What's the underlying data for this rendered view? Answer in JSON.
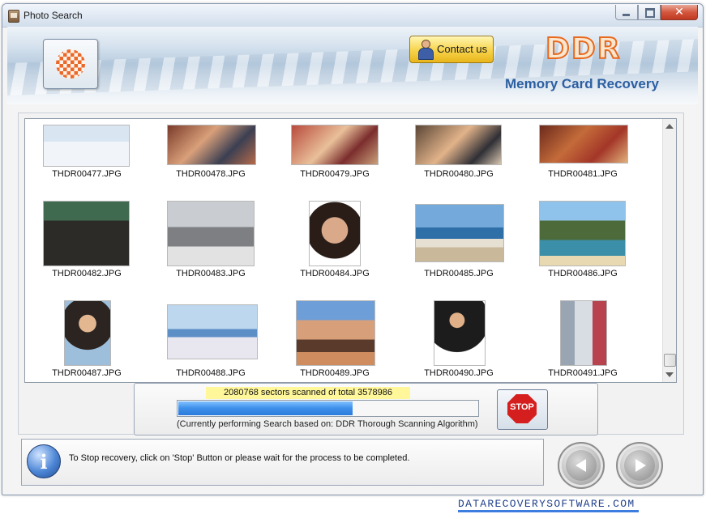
{
  "window": {
    "title": "Photo Search",
    "close_glyph": "✕",
    "icon": "photo-app-icon"
  },
  "header": {
    "contact_label": "Contact us",
    "brand": "DDR",
    "tagline": "Memory Card Recovery",
    "logo_icon": "checker-logo-icon"
  },
  "gallery": {
    "items": [
      {
        "name": "THDR00477.JPG",
        "photo": "skiers-on-snow"
      },
      {
        "name": "THDR00478.JPG",
        "photo": "group-at-table"
      },
      {
        "name": "THDR00479.JPG",
        "photo": "people-gathering"
      },
      {
        "name": "THDR00480.JPG",
        "photo": "man-at-event"
      },
      {
        "name": "THDR00481.JPG",
        "photo": "crowd-dancing"
      },
      {
        "name": "THDR00482.JPG",
        "photo": "two-men-standing"
      },
      {
        "name": "THDR00483.JPG",
        "photo": "office-desk"
      },
      {
        "name": "THDR00484.JPG",
        "photo": "woman-portrait"
      },
      {
        "name": "THDR00485.JPG",
        "photo": "beach-shore"
      },
      {
        "name": "THDR00486.JPG",
        "photo": "rocky-island-boats"
      },
      {
        "name": "THDR00487.JPG",
        "photo": "woman-posing"
      },
      {
        "name": "THDR00488.JPG",
        "photo": "beach-umbrella"
      },
      {
        "name": "THDR00489.JPG",
        "photo": "group-of-friends"
      },
      {
        "name": "THDR00490.JPG",
        "photo": "businesswoman-seated"
      },
      {
        "name": "THDR00491.JPG",
        "photo": "woman-standing"
      }
    ]
  },
  "progress": {
    "sectors_text": "2080768 sectors scanned of total 3578986",
    "scanned": 2080768,
    "total": 3578986,
    "algorithm_text": "(Currently performing Search based on:  DDR Thorough Scanning Algorithm)",
    "stop_label": "STOP"
  },
  "status": {
    "info_glyph": "i",
    "text": "To Stop recovery, click on 'Stop' Button or please wait for the process to be completed."
  },
  "footer": {
    "link": "DATARECOVERYSOFTWARE.COM"
  },
  "colors": {
    "accent": "#2c5fa2",
    "brand_orange": "#e8691d",
    "progress_fill": "#3d8fea"
  }
}
